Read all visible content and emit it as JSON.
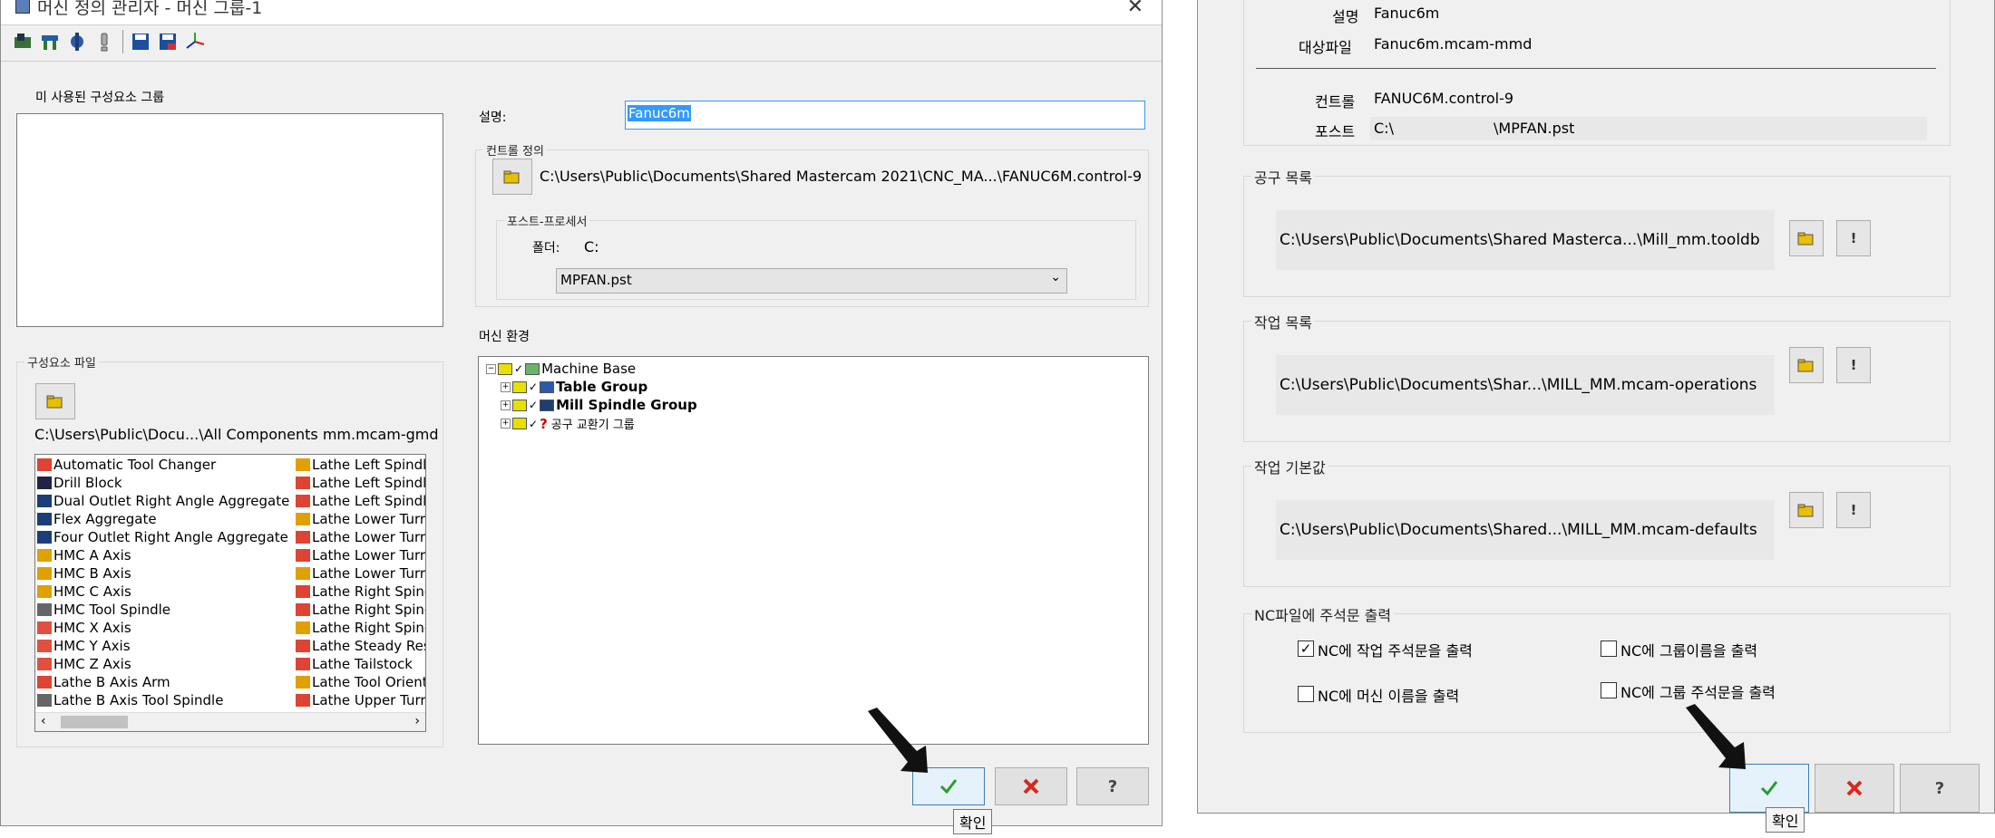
{
  "left_window": {
    "title": "머신 정의 관리자 - 머신 그룹-1",
    "toolbar_icons": [
      "machine-icon",
      "spindle-icon",
      "component-icon",
      "info-icon",
      "save-icon",
      "save-as-icon",
      "axis-icon"
    ],
    "unused_group_label": "미 사용된 구성요소 그룹",
    "component_file_label": "구성요소 파일",
    "component_file_path": "C:\\Users\\Public\\Docu...\\All Components mm.mcam-gmd",
    "components_col1": [
      "Automatic Tool Changer",
      "Drill Block",
      "Dual Outlet Right Angle Aggregate",
      "Flex Aggregate",
      "Four Outlet Right Angle Aggregate",
      "HMC A Axis",
      "HMC B Axis",
      "HMC C Axis",
      "HMC Tool Spindle",
      "HMC X Axis",
      "HMC Y Axis",
      "HMC Z Axis",
      "Lathe B Axis Arm",
      "Lathe B Axis Tool Spindle"
    ],
    "components_col2": [
      "Lathe Left Spindle",
      "Lathe Left Spindle",
      "Lathe Left Spindle",
      "Lathe Lower Turr",
      "Lathe Lower Turr",
      "Lathe Lower Turr",
      "Lathe Lower Turr",
      "Lathe Right Spinc",
      "Lathe Right Spinc",
      "Lathe Right Spinc",
      "Lathe Steady Rest",
      "Lathe Tailstock",
      "Lathe Tool Orient",
      "Lathe Upper Turr"
    ],
    "description_label": "설명:",
    "description_value": "Fanuc6m",
    "control_def_label": "컨트롤 정의",
    "control_path": "C:\\Users\\Public\\Documents\\Shared Mastercam 2021\\CNC_MA...\\FANUC6M.control-9",
    "post_processor_label": "포스트-프로세서",
    "folder_label": "폴더:",
    "folder_value": "C:",
    "post_selected": "MPFAN.pst",
    "machine_env_label": "머신 환경",
    "tree": {
      "root": "Machine Base",
      "children": [
        "Table Group",
        "Mill Spindle Group",
        "공구 교환기 그룹"
      ]
    },
    "ok_tooltip": "확인"
  },
  "right_window": {
    "desc_label": "설명",
    "desc_value": "Fanuc6m",
    "target_file_label": "대상파일",
    "target_file_value": "Fanuc6m.mcam-mmd",
    "control_label": "컨트롤",
    "control_value": "FANUC6M.control-9",
    "post_label": "포스트",
    "post_value_prefix": "C:\\",
    "post_value_suffix": "\\MPFAN.pst",
    "tool_list_label": "공구 목록",
    "tool_list_path": "C:\\Users\\Public\\Documents\\Shared Masterca...\\Mill_mm.tooldb",
    "op_list_label": "작업 목록",
    "op_list_path": "C:\\Users\\Public\\Documents\\Shar...\\MILL_MM.mcam-operations",
    "op_default_label": "작업 기본값",
    "op_default_path": "C:\\Users\\Public\\Documents\\Shared...\\MILL_MM.mcam-defaults",
    "nc_comment_label": "NC파일에 주석문 출력",
    "nc_checks": [
      {
        "label": "NC에 작업 주석문을 출력",
        "checked": true
      },
      {
        "label": "NC에 그룹이름을 출력",
        "checked": false
      },
      {
        "label": "NC에 머신 이름을 출력",
        "checked": false
      },
      {
        "label": "NC에 그룹 주석문을 출력",
        "checked": false
      }
    ],
    "ok_tooltip": "확인"
  },
  "colors": {
    "window_bg": "#f0f0f0",
    "ok_check": "#2a9d2a",
    "cancel_x": "#d62a1e",
    "selection": "#3399ff"
  }
}
